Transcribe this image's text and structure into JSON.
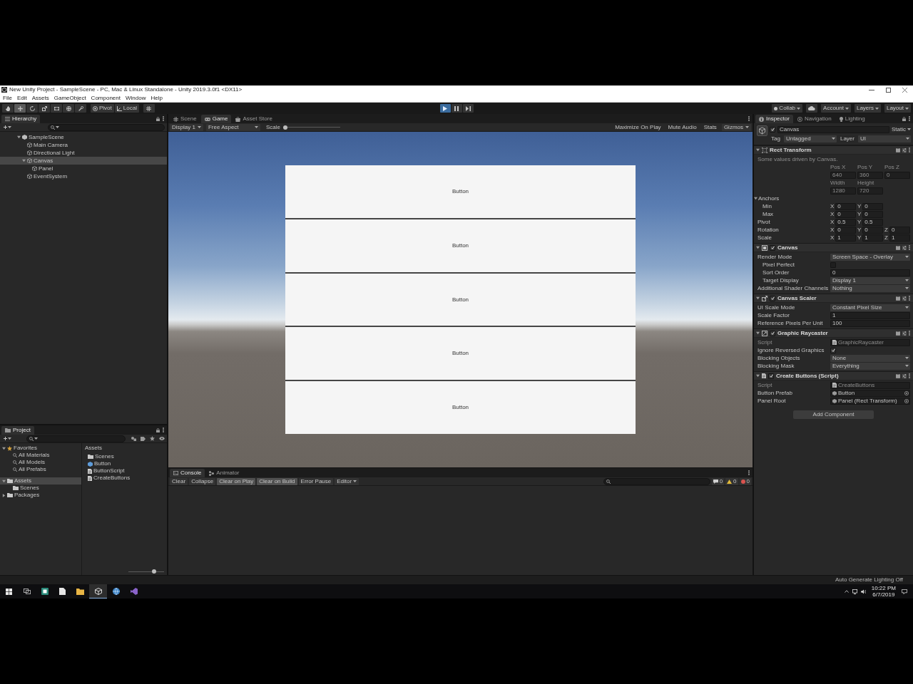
{
  "window": {
    "title": "New Unity Project - SampleScene - PC, Mac & Linux Standalone - Unity 2019.3.0f1 <DX11>"
  },
  "menu": [
    "File",
    "Edit",
    "Assets",
    "GameObject",
    "Component",
    "Window",
    "Help"
  ],
  "toolbar": {
    "tools": [
      {
        "kind": "hand",
        "selected": false
      },
      {
        "kind": "move",
        "selected": true
      },
      {
        "kind": "rotate",
        "selected": false
      },
      {
        "kind": "scale",
        "selected": false
      },
      {
        "kind": "rect",
        "selected": false
      },
      {
        "kind": "transform",
        "selected": false
      },
      {
        "kind": "custom",
        "selected": false
      }
    ],
    "pivot": "Pivot",
    "space": "Local",
    "playback": [
      {
        "kind": "play",
        "selected": true
      },
      {
        "kind": "pause",
        "selected": false
      },
      {
        "kind": "step",
        "selected": false
      }
    ],
    "collab": "Collab",
    "account": "Account",
    "layers": "Layers",
    "layout": "Layout"
  },
  "hierarchy": {
    "title": "Hierarchy",
    "tree": [
      {
        "label": "SampleScene",
        "kind": "scene",
        "expanded": true,
        "selected": false,
        "children": [
          {
            "label": "Main Camera",
            "kind": "object",
            "selected": false
          },
          {
            "label": "Directional Light",
            "kind": "object",
            "selected": false
          },
          {
            "label": "Canvas",
            "kind": "object",
            "expanded": true,
            "selected": true,
            "children": [
              {
                "label": "Panel",
                "kind": "object",
                "selected": false
              }
            ]
          },
          {
            "label": "EventSystem",
            "kind": "object",
            "selected": false
          }
        ]
      }
    ]
  },
  "project": {
    "title": "Project",
    "tree": [
      {
        "label": "Favorites",
        "kind": "favorites",
        "expanded": true,
        "selected": false,
        "children": [
          {
            "label": "All Materials",
            "kind": "search",
            "selected": false
          },
          {
            "label": "All Models",
            "kind": "search",
            "selected": false
          },
          {
            "label": "All Prefabs",
            "kind": "search",
            "selected": false
          }
        ]
      },
      {
        "label": "Assets",
        "kind": "folder",
        "expanded": true,
        "selected": true,
        "children": [
          {
            "label": "Scenes",
            "kind": "folder",
            "selected": false
          }
        ]
      },
      {
        "label": "Packages",
        "kind": "folder",
        "expanded": false,
        "selected": false
      }
    ],
    "path": "Assets",
    "items": [
      {
        "label": "Scenes",
        "kind": "folder"
      },
      {
        "label": "Button",
        "kind": "prefab"
      },
      {
        "label": "ButtonScript",
        "kind": "script"
      },
      {
        "label": "CreateButtons",
        "kind": "script"
      }
    ],
    "icon_size": {
      "level": 0.75
    }
  },
  "view_tabs": [
    {
      "label": "Scene",
      "kind": "scene",
      "selected": false
    },
    {
      "label": "Game",
      "kind": "game",
      "selected": true
    },
    {
      "label": "Asset Store",
      "kind": "store",
      "selected": false
    }
  ],
  "game_toolbar": {
    "display": "Display 1",
    "aspect": "Free Aspect",
    "scale": {
      "label": "Scale",
      "level": 0
    },
    "toggles": [
      {
        "label": "Maximize On Play",
        "on": false
      },
      {
        "label": "Mute Audio",
        "on": false
      },
      {
        "label": "Stats",
        "on": false
      }
    ],
    "gizmos": "Gizmos"
  },
  "game_view": {
    "buttons": [
      {
        "label": "Button"
      },
      {
        "label": "Button"
      },
      {
        "label": "Button"
      },
      {
        "label": "Button"
      },
      {
        "label": "Button"
      }
    ]
  },
  "console": {
    "tabs": [
      {
        "label": "Console",
        "kind": "console",
        "selected": true
      },
      {
        "label": "Animator",
        "kind": "animator",
        "selected": false
      }
    ],
    "actions": [
      {
        "label": "Clear",
        "kind": "button"
      },
      {
        "label": "Collapse",
        "kind": "toggle",
        "on": false
      },
      {
        "label": "Clear on Play",
        "kind": "toggle",
        "on": true
      },
      {
        "label": "Clear on Build",
        "kind": "toggle",
        "on": true
      },
      {
        "label": "Error Pause",
        "kind": "toggle",
        "on": false
      },
      {
        "label": "Editor",
        "kind": "dropdown"
      }
    ],
    "counts": [
      {
        "kind": "message",
        "count": "0"
      },
      {
        "kind": "warning",
        "count": "0"
      },
      {
        "kind": "error",
        "count": "0"
      }
    ]
  },
  "inspector": {
    "tabs": [
      {
        "label": "Inspector",
        "kind": "inspector",
        "selected": true
      },
      {
        "label": "Navigation",
        "kind": "navigation",
        "selected": false
      },
      {
        "label": "Lighting",
        "kind": "lighting",
        "selected": false
      }
    ],
    "object": {
      "active": true,
      "name": "Canvas",
      "static": "Static",
      "tag_label": "Tag",
      "tag": "Untagged",
      "layer_label": "Layer",
      "layer": "UI"
    },
    "components": [
      {
        "kind": "rect_transform",
        "name": "Rect Transform",
        "expanded": true,
        "driven": {
          "note": "Some values driven by Canvas.",
          "grid": [
            {
              "labels": [
                "Pos X",
                "Pos Y",
                "Pos Z"
              ],
              "values": [
                "640",
                "360",
                "0"
              ]
            },
            {
              "labels": [
                "Width",
                "Height"
              ],
              "values": [
                "1280",
                "720"
              ]
            }
          ]
        },
        "rows": [
          {
            "kind": "foldout",
            "label": "Anchors",
            "expanded": true,
            "children": [
              {
                "kind": "vector",
                "label": "Min",
                "fields": [
                  {
                    "axis": "X",
                    "value": "0"
                  },
                  {
                    "axis": "Y",
                    "value": "0"
                  }
                ]
              },
              {
                "kind": "vector",
                "label": "Max",
                "fields": [
                  {
                    "axis": "X",
                    "value": "0"
                  },
                  {
                    "axis": "Y",
                    "value": "0"
                  }
                ]
              }
            ]
          },
          {
            "kind": "vector",
            "label": "Pivot",
            "fields": [
              {
                "axis": "X",
                "value": "0.5"
              },
              {
                "axis": "Y",
                "value": "0.5"
              }
            ]
          },
          {
            "kind": "vector",
            "label": "Rotation",
            "fields": [
              {
                "axis": "X",
                "value": "0"
              },
              {
                "axis": "Y",
                "value": "0"
              },
              {
                "axis": "Z",
                "value": "0"
              }
            ]
          },
          {
            "kind": "vector",
            "label": "Scale",
            "fields": [
              {
                "axis": "X",
                "value": "1"
              },
              {
                "axis": "Y",
                "value": "1"
              },
              {
                "axis": "Z",
                "value": "1"
              }
            ]
          }
        ]
      },
      {
        "kind": "canvas",
        "name": "Canvas",
        "enabled": true,
        "expanded": true,
        "rows": [
          {
            "kind": "dropdown",
            "label": "Render Mode",
            "value": "Screen Space - Overlay",
            "children": [
              {
                "kind": "check",
                "label": "Pixel Perfect",
                "checked": false
              },
              {
                "kind": "text",
                "label": "Sort Order",
                "value": "0"
              },
              {
                "kind": "dropdown",
                "label": "Target Display",
                "value": "Display 1"
              }
            ]
          },
          {
            "kind": "dropdown",
            "label": "Additional Shader Channels",
            "value": "Nothing"
          }
        ]
      },
      {
        "kind": "canvas_scaler",
        "name": "Canvas Scaler",
        "enabled": true,
        "expanded": true,
        "rows": [
          {
            "kind": "dropdown",
            "label": "UI Scale Mode",
            "value": "Constant Pixel Size"
          },
          {
            "kind": "text",
            "label": "Scale Factor",
            "value": "1"
          },
          {
            "kind": "text",
            "label": "Reference Pixels Per Unit",
            "value": "100"
          }
        ]
      },
      {
        "kind": "graphic_raycaster",
        "name": "Graphic Raycaster",
        "enabled": true,
        "expanded": true,
        "rows": [
          {
            "kind": "script",
            "label": "Script",
            "value": "GraphicRaycaster"
          },
          {
            "kind": "check",
            "label": "Ignore Reversed Graphics",
            "checked": true
          },
          {
            "kind": "dropdown",
            "label": "Blocking Objects",
            "value": "None"
          },
          {
            "kind": "dropdown",
            "label": "Blocking Mask",
            "value": "Everything"
          }
        ]
      },
      {
        "kind": "script",
        "name": "Create Buttons (Script)",
        "enabled": true,
        "expanded": true,
        "rows": [
          {
            "kind": "script",
            "label": "Script",
            "value": "CreateButtons"
          },
          {
            "kind": "object",
            "label": "Button Prefab",
            "value": "Button"
          },
          {
            "kind": "object",
            "label": "Panel Root",
            "value": "Panel (Rect Transform)"
          }
        ]
      }
    ],
    "add_component": "Add Component"
  },
  "status_bar": {
    "text": "Auto Generate Lighting Off"
  },
  "taskbar": {
    "apps": [
      {
        "kind": "tile",
        "selected": false
      },
      {
        "kind": "page",
        "selected": false
      },
      {
        "kind": "folder",
        "selected": false
      },
      {
        "kind": "editor",
        "selected": true
      },
      {
        "kind": "globe",
        "selected": false
      },
      {
        "kind": "ribbon",
        "selected": false
      }
    ],
    "time": "10:22 PM",
    "date": "6/7/2019"
  }
}
